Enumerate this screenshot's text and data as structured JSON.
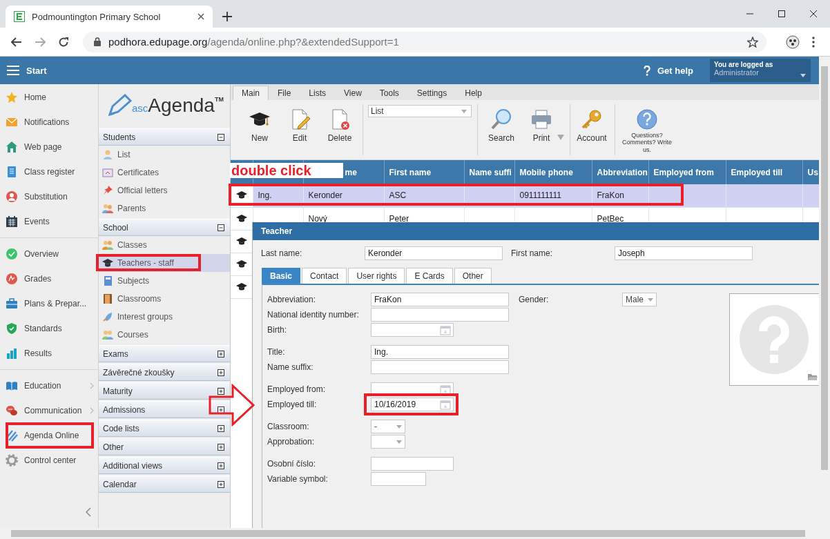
{
  "browser": {
    "tab_title": "Podmountington Primary School",
    "url_host": "podhora.edupage.org",
    "url_path": "/agenda/online.php?&extendedSupport=1"
  },
  "header": {
    "menu_label": "Start",
    "help_label": "Get help",
    "login_caption": "You are logged as",
    "login_user": "Administrator"
  },
  "nav": {
    "groups": [
      {
        "items": [
          {
            "label": "Home",
            "submenu": false
          },
          {
            "label": "Notifications",
            "submenu": false
          },
          {
            "label": "Web page",
            "submenu": false
          },
          {
            "label": "Class register",
            "submenu": false
          },
          {
            "label": "Substitution",
            "submenu": false
          },
          {
            "label": "Events",
            "submenu": false
          }
        ]
      },
      {
        "items": [
          {
            "label": "Overview",
            "submenu": false
          },
          {
            "label": "Grades",
            "submenu": false
          },
          {
            "label": "Plans & Prepar...",
            "submenu": false
          },
          {
            "label": "Standards",
            "submenu": false
          },
          {
            "label": "Results",
            "submenu": false
          }
        ]
      },
      {
        "items": [
          {
            "label": "Education",
            "submenu": true
          },
          {
            "label": "Communication",
            "submenu": true
          },
          {
            "label": "Agenda Online",
            "submenu": false
          },
          {
            "label": "Control center",
            "submenu": false
          }
        ]
      }
    ]
  },
  "modules": {
    "logo": {
      "prefix": "asc",
      "name": "Agenda",
      "mark": "TM"
    },
    "sections": [
      {
        "title": "Students",
        "expanded": true,
        "items": [
          {
            "label": "List",
            "selected": false
          },
          {
            "label": "Certificates",
            "selected": false
          },
          {
            "label": "Official letters",
            "selected": false
          },
          {
            "label": "Parents",
            "selected": false
          }
        ]
      },
      {
        "title": "School",
        "expanded": true,
        "items": [
          {
            "label": "Classes",
            "selected": false
          },
          {
            "label": "Teachers - staff",
            "selected": true
          },
          {
            "label": "Subjects",
            "selected": false
          },
          {
            "label": "Classrooms",
            "selected": false
          },
          {
            "label": "Interest groups",
            "selected": false
          },
          {
            "label": "Courses",
            "selected": false
          }
        ]
      },
      {
        "title": "Exams",
        "expanded": false
      },
      {
        "title": "Závěrečné zkoušky",
        "expanded": false
      },
      {
        "title": "Maturity",
        "expanded": false
      },
      {
        "title": "Admissions",
        "expanded": false
      },
      {
        "title": "Code lists",
        "expanded": false
      },
      {
        "title": "Other",
        "expanded": false
      },
      {
        "title": "Additional views",
        "expanded": false
      },
      {
        "title": "Calendar",
        "expanded": false
      }
    ]
  },
  "menu_tabs": [
    {
      "label": "Main",
      "selected": true
    },
    {
      "label": "File",
      "selected": false
    },
    {
      "label": "Lists",
      "selected": false
    },
    {
      "label": "View",
      "selected": false
    },
    {
      "label": "Tools",
      "selected": false
    },
    {
      "label": "Settings",
      "selected": false
    },
    {
      "label": "Help",
      "selected": false
    }
  ],
  "toolbar": {
    "groups": [
      {
        "items": [
          {
            "kind": "button",
            "label": "New"
          },
          {
            "kind": "button",
            "label": "Edit"
          },
          {
            "kind": "button",
            "label": "Delete"
          }
        ]
      },
      {
        "items": [
          {
            "kind": "dropdown",
            "value": "List"
          }
        ]
      },
      {
        "items": [
          {
            "kind": "button",
            "label": "Search"
          },
          {
            "kind": "menu_button",
            "label": "Print"
          }
        ]
      },
      {
        "items": [
          {
            "kind": "button",
            "label": "Account"
          }
        ]
      },
      {
        "items": [
          {
            "kind": "note",
            "label": "Questions? Comments? Write us."
          }
        ]
      }
    ]
  },
  "table": {
    "columns": [
      {},
      {},
      {
        "label": "me"
      },
      {
        "label": "First name"
      },
      {
        "label": "Name suffi"
      },
      {
        "label": "Mobile phone"
      },
      {
        "label": "Abbreviation"
      },
      {
        "label": "Employed from"
      },
      {
        "label": "Employed till"
      },
      {
        "label": "Us"
      }
    ],
    "rows": [
      {
        "selected": true,
        "cells": [
          {
            "text": "Ing."
          },
          {
            "text": "Keronder"
          },
          {
            "text": "ASC"
          },
          {},
          {
            "text": "0911111111"
          },
          {
            "text": "FraKon"
          },
          {},
          {},
          {}
        ]
      },
      {
        "selected": false,
        "cells": [
          {},
          {
            "text": "Nový"
          },
          {
            "text": "Peter"
          },
          {},
          {},
          {
            "text": "PetBec"
          },
          {},
          {},
          {}
        ]
      },
      {},
      {},
      {}
    ]
  },
  "annotation": {
    "label": "double click"
  },
  "dialog": {
    "title": "Teacher",
    "last_name_label": "Last name:",
    "last_name": "Keronder",
    "first_name_label": "First name:",
    "first_name": "Joseph",
    "tabs": [
      {
        "label": "Basic",
        "selected": true
      },
      {
        "label": "Contact",
        "selected": false
      },
      {
        "label": "User rights",
        "selected": false
      },
      {
        "label": "E Cards",
        "selected": false
      },
      {
        "label": "Other",
        "selected": false
      }
    ],
    "side_field": {
      "label": "Gender:",
      "kind": "select",
      "value": "Male"
    },
    "field_groups": [
      {
        "fields": [
          {
            "label": "Abbreviation:",
            "kind": "text",
            "value": "FraKon"
          },
          {
            "label": "National identity number:",
            "kind": "text"
          },
          {
            "label": "Birth:",
            "kind": "date"
          }
        ]
      },
      {
        "fields": [
          {
            "label": "Title:",
            "kind": "text",
            "value": "Ing."
          },
          {
            "label": "Name suffix:",
            "kind": "text"
          }
        ]
      },
      {
        "fields": [
          {
            "label": "Employed from:",
            "kind": "date"
          },
          {
            "label": "Employed till:",
            "kind": "date",
            "value": "10/16/2019"
          }
        ]
      },
      {
        "fields": [
          {
            "label": "Classroom:",
            "kind": "select",
            "value": "-"
          },
          {
            "label": "Approbation:",
            "kind": "select"
          }
        ]
      },
      {
        "fields": [
          {
            "label": "Osobní číslo:",
            "kind": "short"
          },
          {
            "label": "Variable symbol:",
            "kind": "tiny"
          }
        ]
      }
    ]
  }
}
